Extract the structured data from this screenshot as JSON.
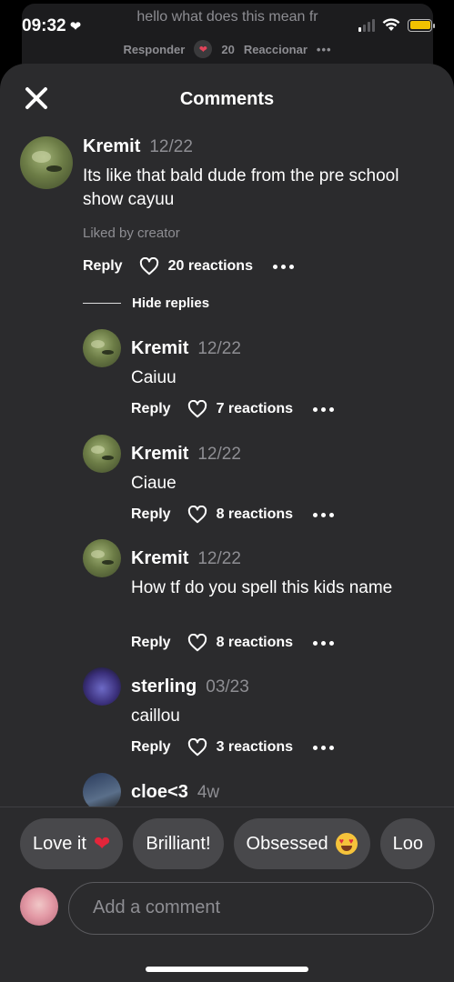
{
  "status_bar": {
    "time": "09:32",
    "time_icon": "heart-icon"
  },
  "background_post": {
    "message": "hello what does this mean fr",
    "reply_label": "Responder",
    "reaction_count": "20",
    "react_label": "Reaccionar"
  },
  "sheet": {
    "title": "Comments",
    "close_icon": "close-icon"
  },
  "comments": [
    {
      "name": "Kremit",
      "date": "12/22",
      "text": "Its like that bald dude from the pre school show cayuu",
      "liked_by": "Liked by creator",
      "reply_label": "Reply",
      "reactions": "20 reactions"
    }
  ],
  "hide_replies_label": "Hide replies",
  "replies": [
    {
      "name": "Kremit",
      "date": "12/22",
      "text": "Caiuu",
      "reply_label": "Reply",
      "reactions": "7 reactions"
    },
    {
      "name": "Kremit",
      "date": "12/22",
      "text": "Ciaue",
      "reply_label": "Reply",
      "reactions": "8 reactions"
    },
    {
      "name": "Kremit",
      "date": "12/22",
      "text": "How tf do you spell this kids name",
      "reply_label": "Reply",
      "reactions": "8 reactions"
    },
    {
      "name": "sterling",
      "date": "03/23",
      "text": "caillou",
      "reply_label": "Reply",
      "reactions": "3 reactions"
    },
    {
      "name": "cloe<3",
      "date": "4w"
    }
  ],
  "quick_reactions": [
    "Love it",
    "Brilliant!",
    "Obsessed",
    "Loo"
  ],
  "composer": {
    "placeholder": "Add a comment"
  },
  "colors": {
    "sheet_bg": "#2b2b2d",
    "chip_bg": "#48484b",
    "muted_text": "#8e8e93",
    "battery": "#f2c200"
  }
}
